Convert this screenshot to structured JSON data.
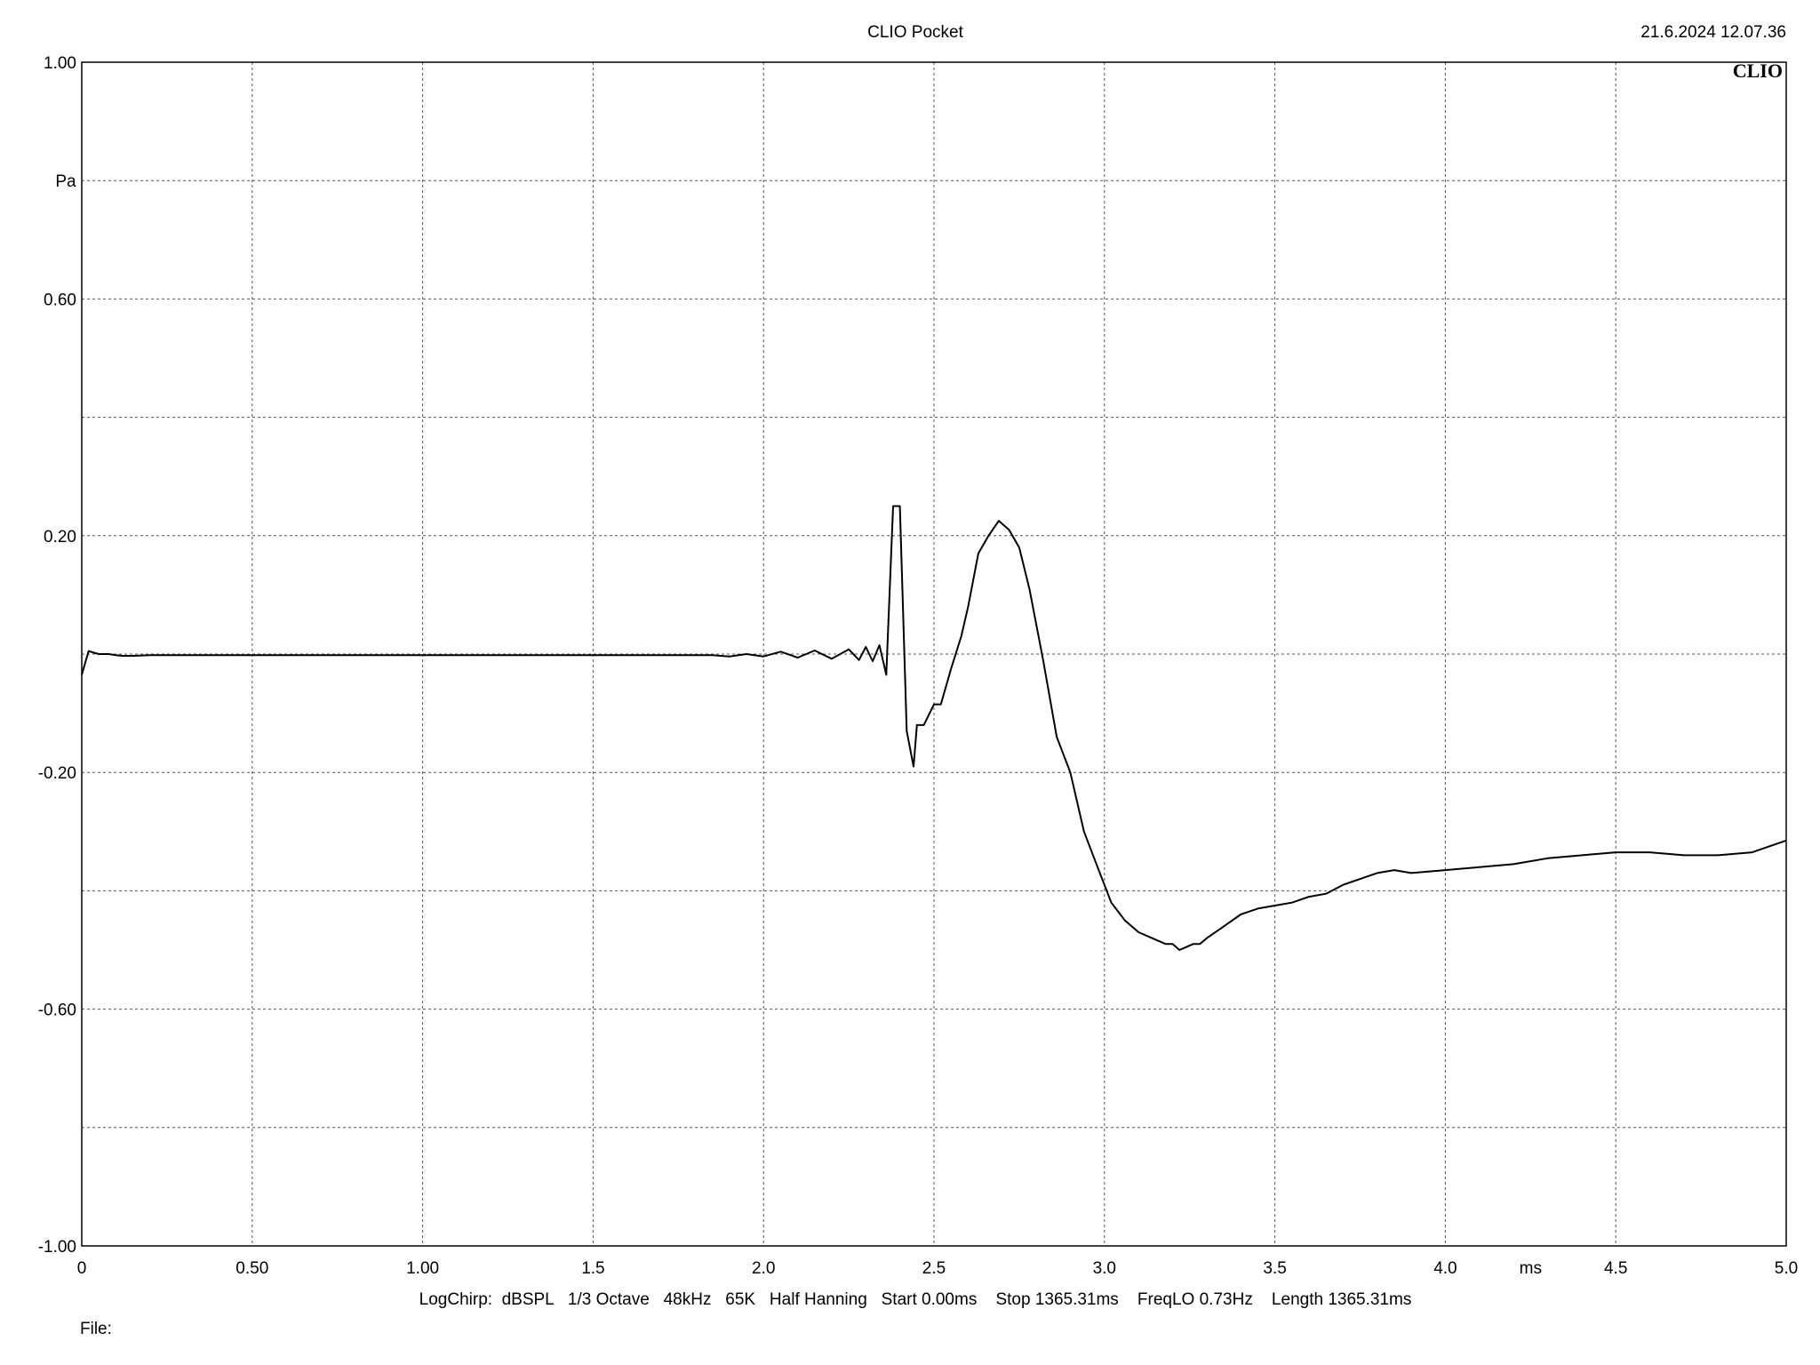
{
  "header": {
    "title": "CLIO Pocket",
    "timestamp": "21.6.2024 12.07.36",
    "logo": "CLIO"
  },
  "footer": {
    "settings": "LogChirp:  dBSPL   1/3 Octave   48kHz   65K   Half Hanning   Start 0.00ms    Stop 1365.31ms    FreqLO 0.73Hz    Length 1365.31ms",
    "file_label": "File:"
  },
  "chart_data": {
    "type": "line",
    "title": "",
    "xlabel": "ms",
    "ylabel": "Pa",
    "xlim": [
      0,
      5.0
    ],
    "ylim": [
      -1.0,
      1.0
    ],
    "grid": true,
    "x_ticks": [
      {
        "value": 0,
        "label": "0"
      },
      {
        "value": 0.5,
        "label": "0.50"
      },
      {
        "value": 1.0,
        "label": "1.00"
      },
      {
        "value": 1.5,
        "label": "1.5"
      },
      {
        "value": 2.0,
        "label": "2.0"
      },
      {
        "value": 2.5,
        "label": "2.5"
      },
      {
        "value": 3.0,
        "label": "3.0"
      },
      {
        "value": 3.5,
        "label": "3.5"
      },
      {
        "value": 4.0,
        "label": "4.0"
      },
      {
        "value": 4.5,
        "label": "4.5"
      },
      {
        "value": 5.0,
        "label": "5.0"
      }
    ],
    "x_unit_value": 4.25,
    "y_ticks": [
      {
        "value": 1.0,
        "label": "1.00"
      },
      {
        "value": 0.6,
        "label": "0.60"
      },
      {
        "value": 0.2,
        "label": "0.20"
      },
      {
        "value": -0.2,
        "label": "-0.20"
      },
      {
        "value": -0.6,
        "label": "-0.60"
      },
      {
        "value": -1.0,
        "label": "-1.00"
      }
    ],
    "y_unit_value": 0.8,
    "x_gridlines": [
      0.5,
      1.0,
      1.5,
      2.0,
      2.5,
      3.0,
      3.5,
      4.0,
      4.5
    ],
    "y_gridlines": [
      0.8,
      0.6,
      0.4,
      0.2,
      0.0,
      -0.2,
      -0.4,
      -0.6,
      -0.8
    ],
    "series": [
      {
        "name": "",
        "color": "#000000",
        "x": [
          0.0,
          0.02,
          0.05,
          0.08,
          0.1,
          0.12,
          0.15,
          0.2,
          0.5,
          1.0,
          1.5,
          1.85,
          1.9,
          1.95,
          2.0,
          2.05,
          2.1,
          2.15,
          2.2,
          2.25,
          2.28,
          2.3,
          2.32,
          2.34,
          2.36,
          2.38,
          2.4,
          2.42,
          2.44,
          2.45,
          2.47,
          2.5,
          2.52,
          2.55,
          2.58,
          2.6,
          2.63,
          2.66,
          2.69,
          2.72,
          2.75,
          2.78,
          2.82,
          2.86,
          2.9,
          2.94,
          2.98,
          3.02,
          3.06,
          3.1,
          3.14,
          3.18,
          3.2,
          3.22,
          3.24,
          3.26,
          3.28,
          3.3,
          3.35,
          3.4,
          3.45,
          3.5,
          3.55,
          3.6,
          3.65,
          3.7,
          3.75,
          3.8,
          3.85,
          3.9,
          4.0,
          4.1,
          4.2,
          4.3,
          4.4,
          4.5,
          4.6,
          4.7,
          4.8,
          4.9,
          5.0
        ],
        "y": [
          -0.035,
          0.005,
          0.0,
          0.0,
          -0.002,
          -0.003,
          -0.003,
          -0.002,
          -0.002,
          -0.002,
          -0.002,
          -0.002,
          -0.004,
          0.0,
          -0.004,
          0.004,
          -0.006,
          0.006,
          -0.008,
          0.008,
          -0.01,
          0.012,
          -0.012,
          0.015,
          -0.035,
          0.25,
          0.25,
          -0.13,
          -0.19,
          -0.12,
          -0.12,
          -0.085,
          -0.085,
          -0.025,
          0.03,
          0.08,
          0.17,
          0.2,
          0.225,
          0.21,
          0.18,
          0.11,
          -0.01,
          -0.14,
          -0.2,
          -0.3,
          -0.36,
          -0.42,
          -0.45,
          -0.47,
          -0.48,
          -0.49,
          -0.49,
          -0.5,
          -0.495,
          -0.49,
          -0.49,
          -0.48,
          -0.46,
          -0.44,
          -0.43,
          -0.425,
          -0.42,
          -0.41,
          -0.405,
          -0.39,
          -0.38,
          -0.37,
          -0.365,
          -0.37,
          -0.365,
          -0.36,
          -0.355,
          -0.345,
          -0.34,
          -0.335,
          -0.335,
          -0.34,
          -0.34,
          -0.335,
          -0.315
        ]
      }
    ]
  }
}
